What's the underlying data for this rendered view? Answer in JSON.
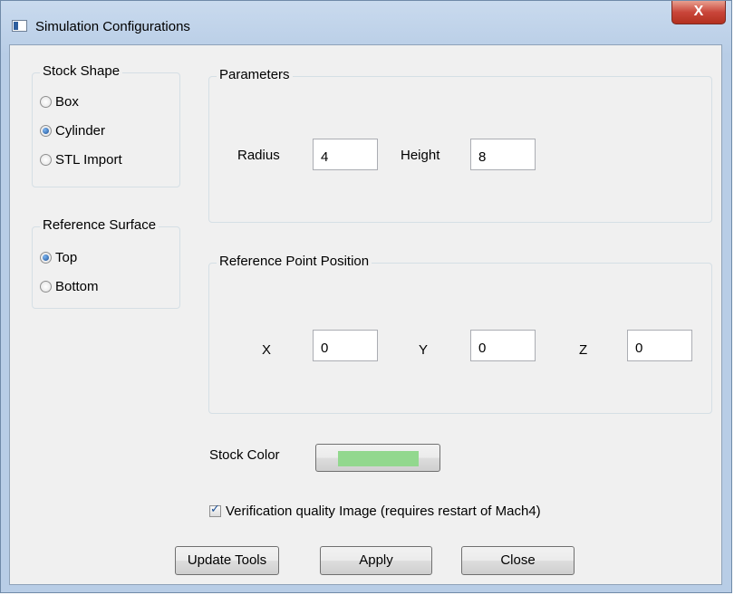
{
  "window": {
    "title": "Simulation Configurations",
    "close_label": "X"
  },
  "stock_shape": {
    "title": "Stock Shape",
    "options": [
      {
        "label": "Box",
        "checked": false
      },
      {
        "label": "Cylinder",
        "checked": true
      },
      {
        "label": "STL Import",
        "checked": false
      }
    ]
  },
  "reference_surface": {
    "title": "Reference Surface",
    "options": [
      {
        "label": "Top",
        "checked": true
      },
      {
        "label": "Bottom",
        "checked": false
      }
    ]
  },
  "parameters": {
    "title": "Parameters",
    "radius_label": "Radius",
    "radius_value": "4",
    "height_label": "Height",
    "height_value": "8"
  },
  "reference_point": {
    "title": "Reference Point Position",
    "x_label": "X",
    "x_value": "0",
    "y_label": "Y",
    "y_value": "0",
    "z_label": "Z",
    "z_value": "0"
  },
  "stock_color": {
    "label": "Stock Color",
    "color": "#92d88e"
  },
  "verification": {
    "label": "Verification quality Image (requires restart of Mach4)",
    "checked": true
  },
  "buttons": {
    "update_tools": "Update Tools",
    "apply": "Apply",
    "close": "Close"
  }
}
